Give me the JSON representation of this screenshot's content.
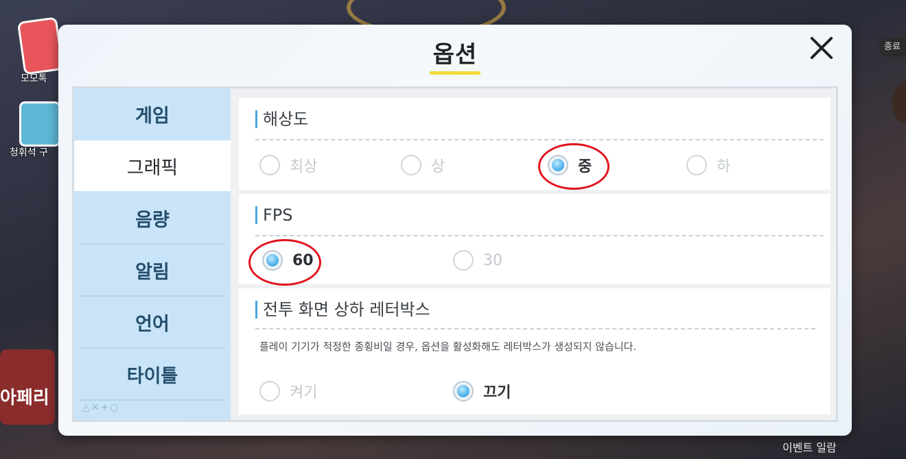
{
  "background": {
    "left_label_1": "모모톡",
    "left_label_2": "청휘석 구",
    "poster_text": "아페리",
    "right_badge": "종료",
    "bottom_right": "이벤트 일람"
  },
  "dialog": {
    "title": "옵션",
    "close_label": "close"
  },
  "sidebar": {
    "tabs": [
      {
        "label": "게임"
      },
      {
        "label": "그래픽"
      },
      {
        "label": "음량"
      },
      {
        "label": "알림"
      },
      {
        "label": "언어"
      },
      {
        "label": "타이틀"
      }
    ],
    "active_tab": "그래픽",
    "deco": "△✕+○"
  },
  "sections": {
    "resolution": {
      "title": "해상도",
      "options": [
        {
          "label": "최상",
          "checked": false
        },
        {
          "label": "상",
          "checked": false
        },
        {
          "label": "중",
          "checked": true
        },
        {
          "label": "하",
          "checked": false
        }
      ]
    },
    "fps": {
      "title": "FPS",
      "options": [
        {
          "label": "60",
          "checked": true
        },
        {
          "label": "30",
          "checked": false
        }
      ]
    },
    "letterbox": {
      "title": "전투 화면 상하 레터박스",
      "description": "플레이 기기가 적정한 종횡비일 경우, 옵션을 활성화해도 레터박스가 생성되지 않습니다.",
      "options": [
        {
          "label": "켜기",
          "checked": false
        },
        {
          "label": "끄기",
          "checked": true
        }
      ]
    }
  },
  "colors": {
    "accent_blue": "#4aa6dd",
    "sidebar_bg": "#c9e4f8",
    "title_underline": "#f4d93a",
    "annotation_red": "#e1141e"
  }
}
